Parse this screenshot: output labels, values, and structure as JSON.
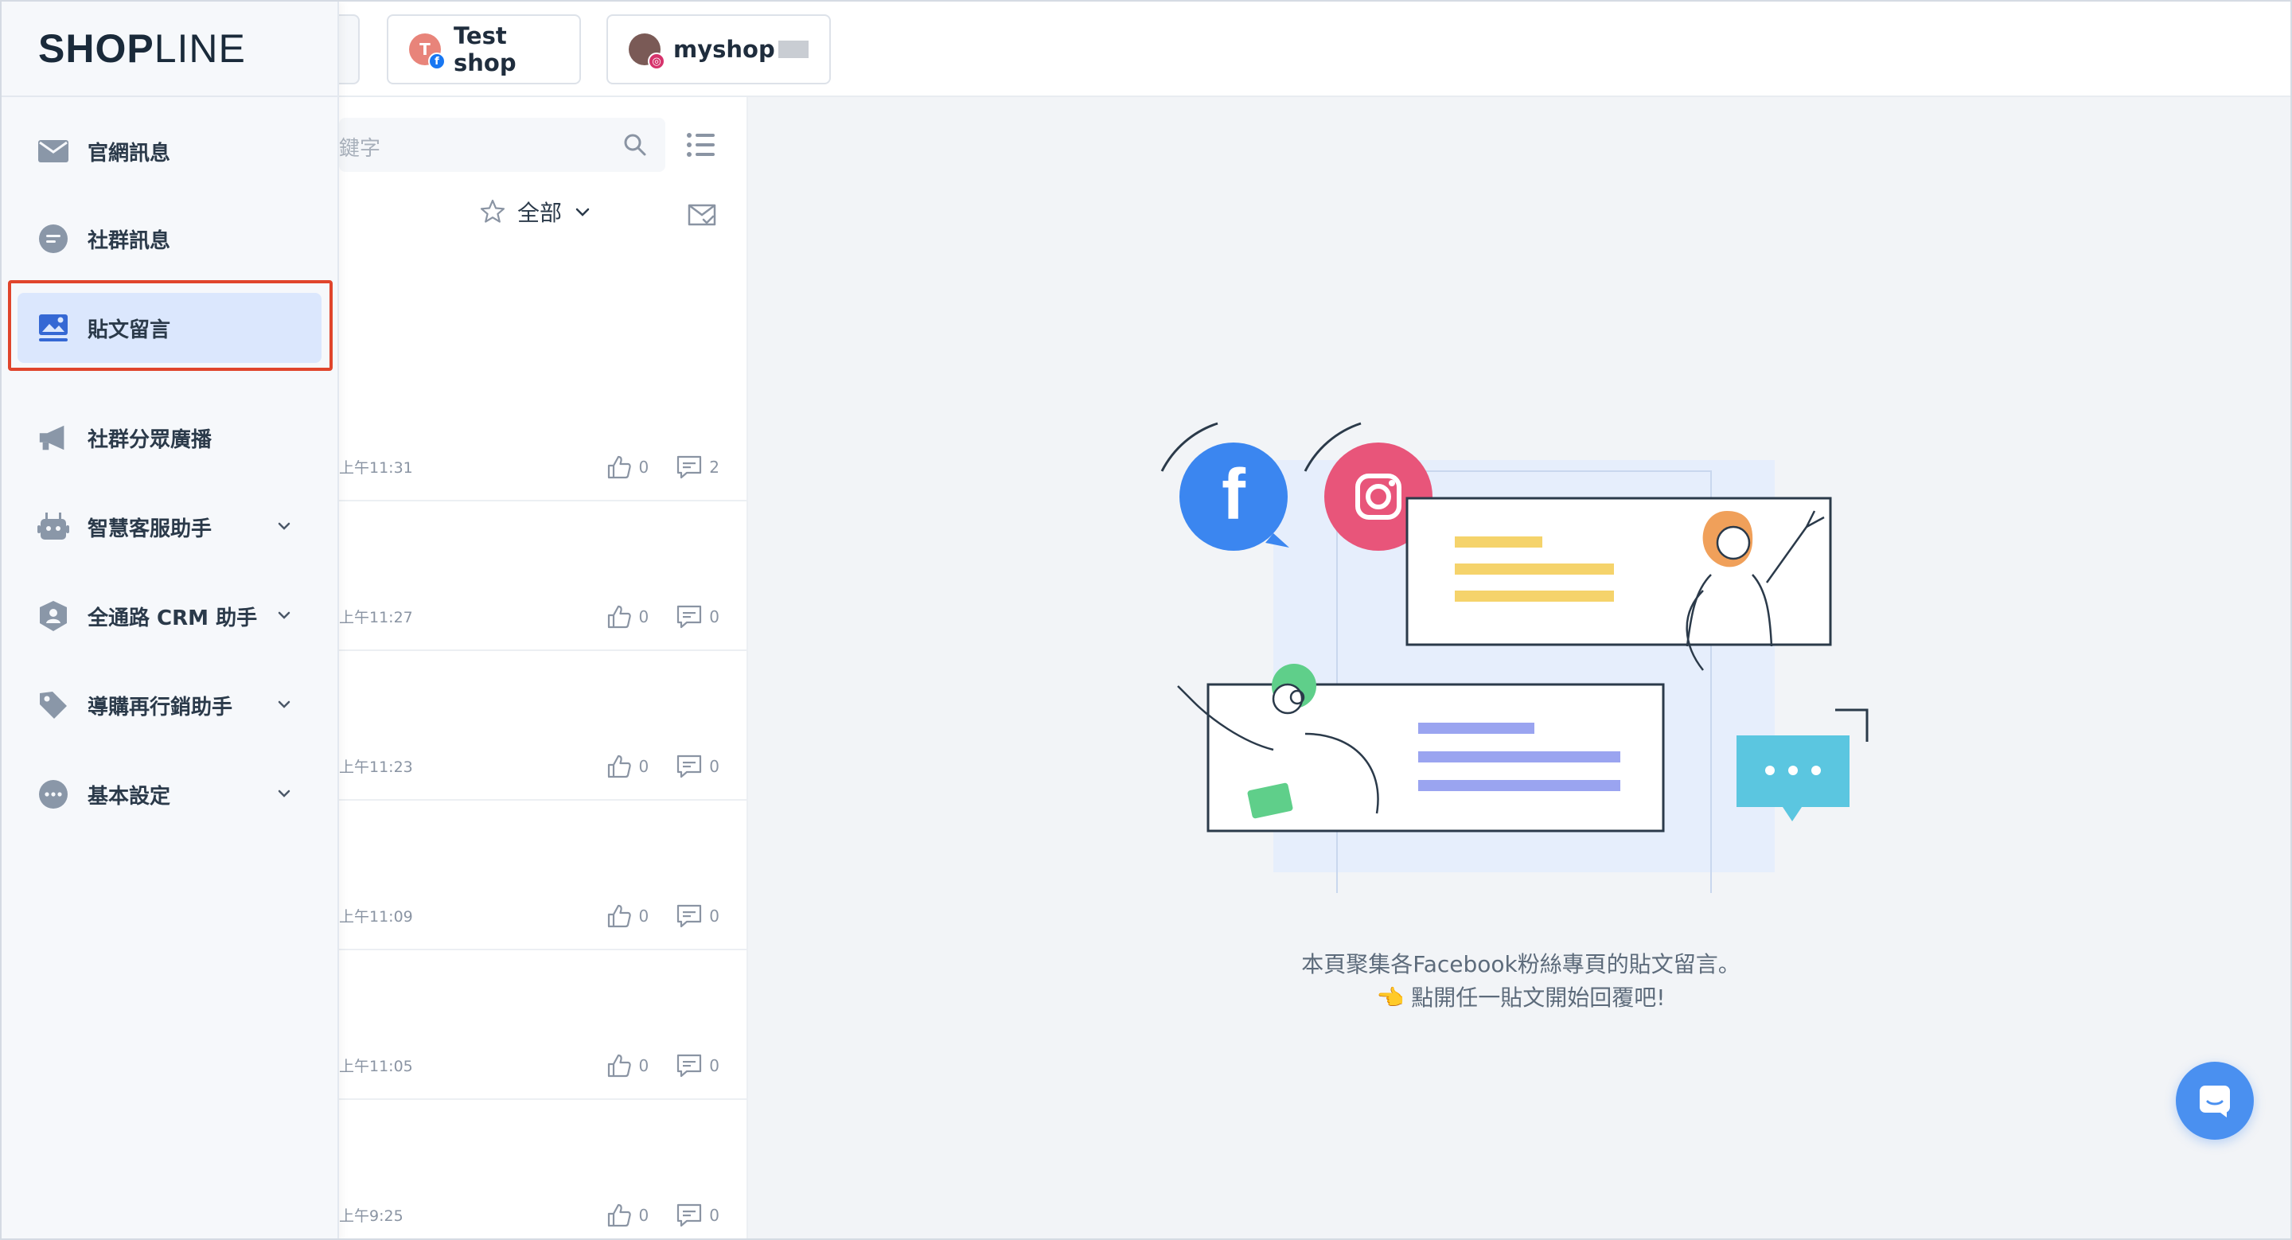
{
  "app": {
    "brand_bold": "SH",
    "brand_mid": "O",
    "brand_p": "P",
    "brand_light": "LINE"
  },
  "accounts": [
    {
      "name": "Test shop",
      "avatar_letter": "T",
      "platform": "facebook"
    },
    {
      "name": "myshop",
      "platform": "instagram"
    }
  ],
  "sidebar": {
    "items": [
      {
        "label": "官網訊息",
        "icon": "mail-icon",
        "active": false
      },
      {
        "label": "社群訊息",
        "icon": "chat-bubble-icon",
        "active": false
      },
      {
        "label": "貼文留言",
        "icon": "image-post-icon",
        "active": true
      },
      {
        "label": "社群分眾廣播",
        "icon": "megaphone-icon",
        "active": false
      },
      {
        "label": "智慧客服助手",
        "icon": "robot-icon",
        "active": false,
        "expandable": true
      },
      {
        "label": "全通路 CRM 助手",
        "icon": "customer-shield-icon",
        "active": false,
        "expandable": true
      },
      {
        "label": "導購再行銷助手",
        "icon": "tag-icon",
        "active": false,
        "expandable": true
      },
      {
        "label": "基本設定",
        "icon": "more-dots-icon",
        "active": false,
        "expandable": true
      }
    ]
  },
  "list": {
    "search_placeholder": "鍵字",
    "filter_label": "全部",
    "posts": [
      {
        "time": "上午11:31",
        "likes": "0",
        "comments": "2"
      },
      {
        "time": "上午11:27",
        "likes": "0",
        "comments": "0"
      },
      {
        "time": "上午11:23",
        "likes": "0",
        "comments": "0"
      },
      {
        "time": "上午11:09",
        "likes": "0",
        "comments": "0"
      },
      {
        "time": "上午11:05",
        "likes": "0",
        "comments": "0"
      },
      {
        "time": "上午9:25",
        "likes": "0",
        "comments": "0"
      }
    ]
  },
  "main": {
    "hint_line1": "本頁聚集各Facebook粉絲專頁的貼文留言。",
    "hint_line2": "👈 點開任一貼文開始回覆吧!"
  },
  "colors": {
    "accent": "#4a90f0",
    "active_bg": "#dbe7fd",
    "highlight": "#e0452c",
    "facebook": "#3b86f0",
    "instagram": "#e8557a",
    "chat_bubble": "#5bc6e0"
  }
}
